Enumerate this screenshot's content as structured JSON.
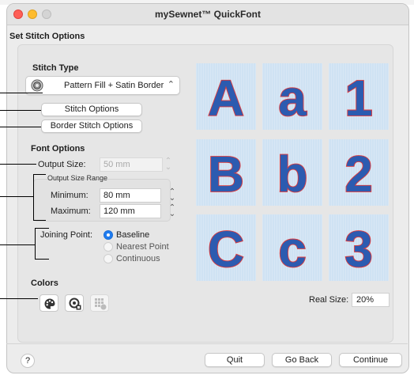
{
  "window": {
    "title": "mySewnet™ QuickFont"
  },
  "page": {
    "section_title": "Set Stitch Options"
  },
  "stitch_type": {
    "heading": "Stitch Type",
    "selected": "Pattern Fill + Satin Border",
    "icon": "fill-pattern-icon",
    "stitch_options_label": "Stitch Options",
    "border_stitch_options_label": "Border Stitch Options"
  },
  "font_options": {
    "heading": "Font Options",
    "output_size_label": "Output Size:",
    "output_size_value": "50 mm",
    "range_heading": "Output Size Range",
    "minimum_label": "Minimum:",
    "minimum_value": "80 mm",
    "maximum_label": "Maximum:",
    "maximum_value": "120 mm",
    "joining_label": "Joining Point:",
    "joining_options": [
      "Baseline",
      "Nearest Point",
      "Continuous"
    ],
    "joining_selected": "Baseline"
  },
  "colors": {
    "heading": "Colors",
    "buttons": [
      "palette-icon",
      "color-picker-icon",
      "color-grid-icon"
    ]
  },
  "preview": {
    "glyphs": [
      "A",
      "a",
      "1",
      "B",
      "b",
      "2",
      "C",
      "c",
      "3"
    ],
    "fill_color": "#2c5bb0",
    "border_color": "#e03a3a",
    "tile_color": "#cfe2f3"
  },
  "real_size": {
    "label": "Real Size:",
    "value": "20%"
  },
  "footer": {
    "help_label": "?",
    "quit_label": "Quit",
    "go_back_label": "Go Back",
    "continue_label": "Continue"
  },
  "colors_theme": {
    "accent": "#1f7cf0"
  }
}
